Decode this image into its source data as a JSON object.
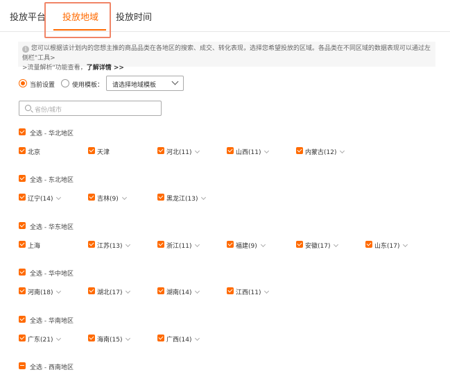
{
  "tabs": [
    {
      "label": "投放平台",
      "active": false
    },
    {
      "label": "投放地域",
      "active": true
    },
    {
      "label": "投放时间",
      "active": false
    }
  ],
  "notice": {
    "line1": "您可以根据该计划内的您想主推的商品品类在各地区的搜索、成交、转化表现，选择您希望投放的区域。各品类在不同区域的数据表现可以通过左侧栏\"工具>",
    "line2": ">流量解析\"功能查看，",
    "link": "了解详情 >>"
  },
  "mode": {
    "current_label": "当前设置",
    "template_label": "使用模板：",
    "select_value": "请选择地域模板"
  },
  "search": {
    "placeholder": "省份/城市"
  },
  "regions": [
    {
      "label": "全选 - 华北地区",
      "partial": false,
      "provinces": [
        {
          "name": "北京",
          "count": "",
          "chevron": false
        },
        {
          "name": "天津",
          "count": "",
          "chevron": false
        },
        {
          "name": "河北",
          "count": "(11)",
          "chevron": true
        },
        {
          "name": "山西",
          "count": "(11)",
          "chevron": true
        },
        {
          "name": "内蒙古",
          "count": "(12)",
          "chevron": true
        }
      ]
    },
    {
      "label": "全选 - 东北地区",
      "partial": false,
      "provinces": [
        {
          "name": "辽宁",
          "count": "(14)",
          "chevron": true
        },
        {
          "name": "吉林",
          "count": "(9)",
          "chevron": true
        },
        {
          "name": "黑龙江",
          "count": "(13)",
          "chevron": true
        }
      ]
    },
    {
      "label": "全选 - 华东地区",
      "partial": false,
      "provinces": [
        {
          "name": "上海",
          "count": "",
          "chevron": false
        },
        {
          "name": "江苏",
          "count": "(13)",
          "chevron": true
        },
        {
          "name": "浙江",
          "count": "(11)",
          "chevron": true
        },
        {
          "name": "福建",
          "count": "(9)",
          "chevron": true
        },
        {
          "name": "安徽",
          "count": "(17)",
          "chevron": true
        },
        {
          "name": "山东",
          "count": "(17)",
          "chevron": true
        }
      ]
    },
    {
      "label": "全选 - 华中地区",
      "partial": false,
      "provinces": [
        {
          "name": "河南",
          "count": "(18)",
          "chevron": true
        },
        {
          "name": "湖北",
          "count": "(17)",
          "chevron": true
        },
        {
          "name": "湖南",
          "count": "(14)",
          "chevron": true
        },
        {
          "name": "江西",
          "count": "(11)",
          "chevron": true
        }
      ]
    },
    {
      "label": "全选 - 华南地区",
      "partial": false,
      "provinces": [
        {
          "name": "广东",
          "count": "(21)",
          "chevron": true
        },
        {
          "name": "海南",
          "count": "(15)",
          "chevron": true
        },
        {
          "name": "广西",
          "count": "(14)",
          "chevron": true
        }
      ]
    },
    {
      "label": "全选 - 西南地区",
      "partial": true,
      "provinces": []
    }
  ],
  "colors": {
    "accent": "#ff6a00",
    "highlight_box": "#f08466"
  }
}
